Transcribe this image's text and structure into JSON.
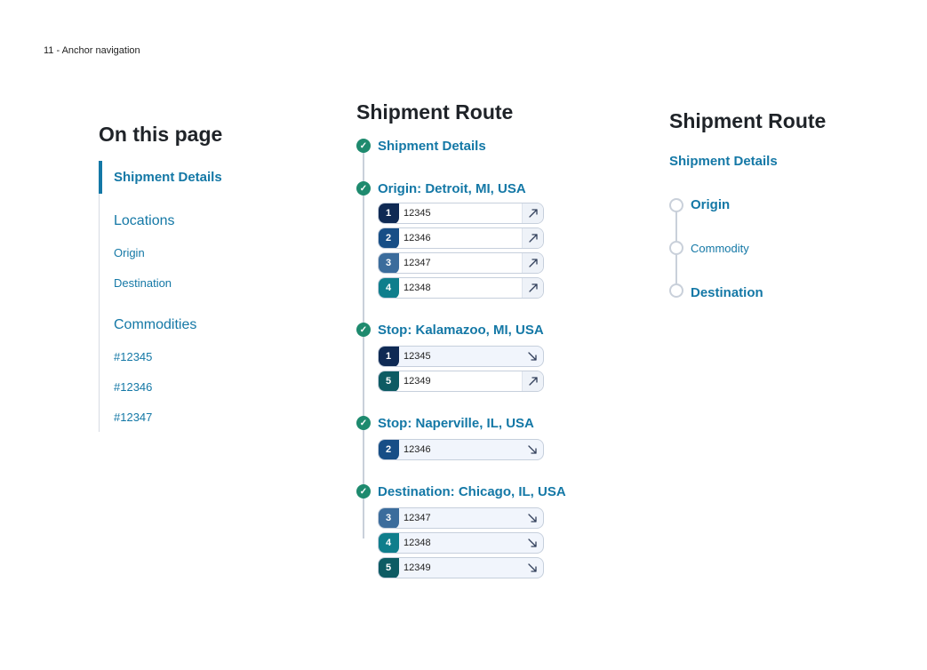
{
  "page_label": "11 - Anchor navigation",
  "toc": {
    "title": "On this page",
    "active": "Shipment Details",
    "locations": "Locations",
    "origin": "Origin",
    "destination": "Destination",
    "commodities": "Commodities",
    "commodity_items": [
      "#12345",
      "#12346",
      "#12347"
    ]
  },
  "route": {
    "title": "Shipment Route",
    "stops": [
      {
        "title": "Shipment Details"
      },
      {
        "title": "Origin: Detroit, MI, USA"
      },
      {
        "title": "Stop: Kalamazoo, MI, USA"
      },
      {
        "title": "Stop: Naperville, IL, USA"
      },
      {
        "title": "Destination: Chicago, IL, USA"
      }
    ],
    "chips": [
      {
        "num": "1",
        "code": "12345",
        "direction": "pickup",
        "color": "#0f2a54"
      },
      {
        "num": "2",
        "code": "12346",
        "direction": "pickup",
        "color": "#174e86"
      },
      {
        "num": "3",
        "code": "12347",
        "direction": "pickup",
        "color": "#3b6c9c"
      },
      {
        "num": "4",
        "code": "12348",
        "direction": "pickup",
        "color": "#0f7e8c"
      },
      {
        "num": "1",
        "code": "12345",
        "direction": "drop",
        "color": "#0f2a54"
      },
      {
        "num": "5",
        "code": "12349",
        "direction": "pickup",
        "color": "#0d5b63"
      },
      {
        "num": "2",
        "code": "12346",
        "direction": "drop",
        "color": "#174e86"
      },
      {
        "num": "3",
        "code": "12347",
        "direction": "drop",
        "color": "#3b6c9c"
      },
      {
        "num": "4",
        "code": "12348",
        "direction": "drop",
        "color": "#0f7e8c"
      },
      {
        "num": "5",
        "code": "12349",
        "direction": "drop",
        "color": "#0d5b63"
      }
    ]
  },
  "route2": {
    "title": "Shipment Route",
    "details": "Shipment Details",
    "origin": "Origin",
    "commodity": "Commodity",
    "destination": "Destination"
  },
  "colors": {
    "link": "#1478a6",
    "check": "#1e8a6e",
    "rail": "#c9d0da"
  }
}
